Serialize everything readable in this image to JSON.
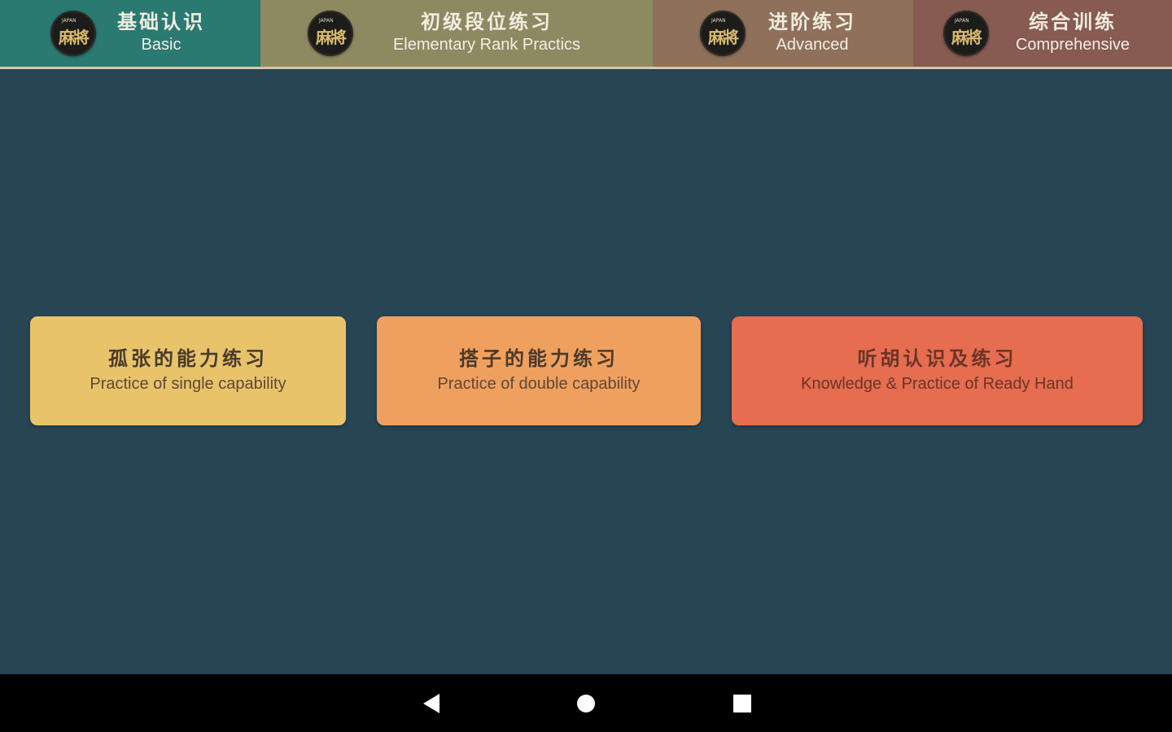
{
  "tabs": [
    {
      "zh": "基础认识",
      "en": "Basic",
      "color": "#2b7a72",
      "selected": true
    },
    {
      "zh": "初级段位练习",
      "en": "Elementary Rank Practics",
      "color": "#8d8a62",
      "selected": false
    },
    {
      "zh": "进阶练习",
      "en": "Advanced",
      "color": "#8f705a",
      "selected": false
    },
    {
      "zh": "综合训练",
      "en": "Comprehensive",
      "color": "#875a52",
      "selected": false
    }
  ],
  "logo": {
    "glyph": "麻將",
    "top_mark": "JAPAN"
  },
  "cards": [
    {
      "zh": "孤张的能力练习",
      "en": "Practice of single capability",
      "color": "#e8c36a"
    },
    {
      "zh": "搭子的能力练习",
      "en": "Practice of double capability",
      "color": "#f0a05e"
    },
    {
      "zh": "听胡认识及练习",
      "en": "Knowledge & Practice of Ready Hand",
      "color": "#e66d50"
    }
  ],
  "navbar": {
    "back_icon": "back-triangle-icon",
    "home_icon": "home-circle-icon",
    "recent_icon": "recents-square-icon"
  },
  "colors": {
    "background": "#274553",
    "navbar": "#000000"
  }
}
